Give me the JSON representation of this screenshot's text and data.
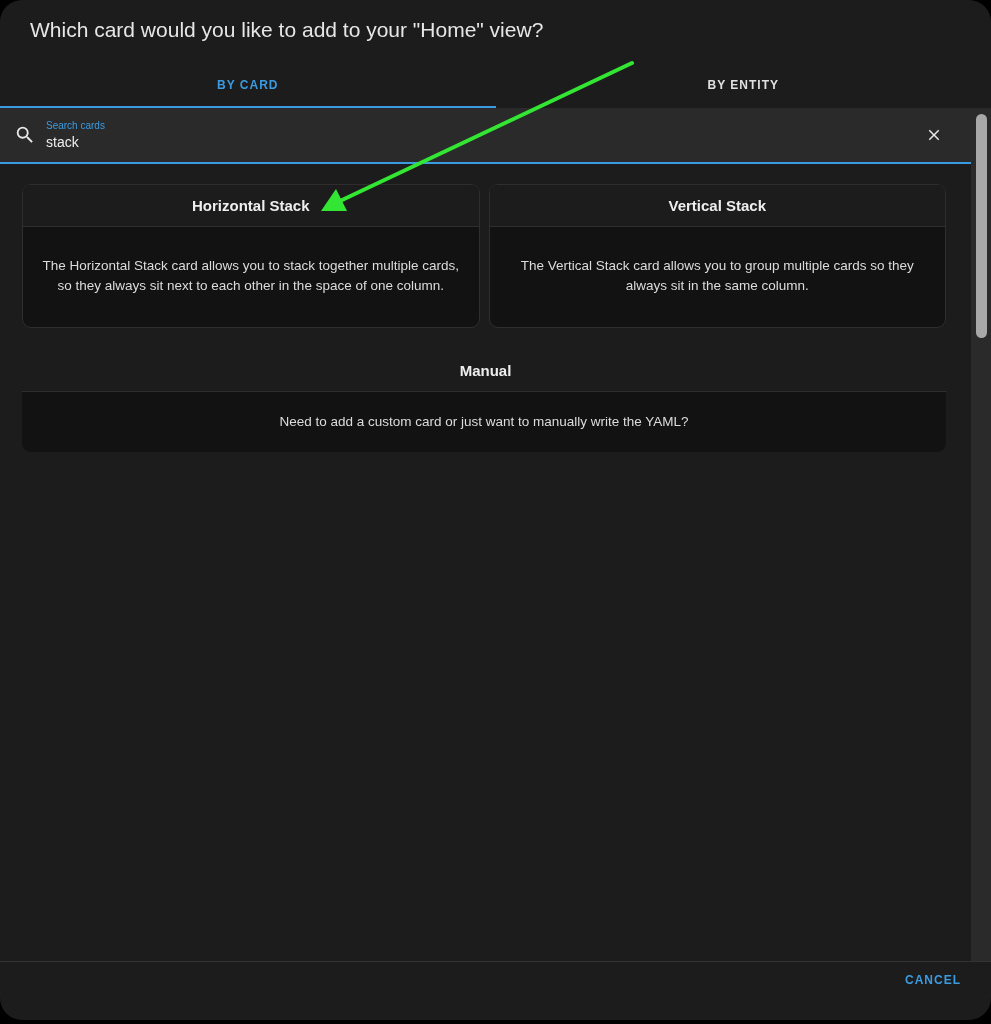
{
  "dialog": {
    "title": "Which card would you like to add to your \"Home\" view?"
  },
  "tabs": [
    {
      "label": "BY CARD",
      "selected": true
    },
    {
      "label": "BY ENTITY",
      "selected": false
    }
  ],
  "search": {
    "label": "Search cards",
    "value": "stack"
  },
  "cards": [
    {
      "title": "Horizontal Stack",
      "description": "The Horizontal Stack card allows you to stack together multiple cards, so they always sit next to each other in the space of one column."
    },
    {
      "title": "Vertical Stack",
      "description": "The Vertical Stack card allows you to group multiple cards so they always sit in the same column."
    }
  ],
  "manual": {
    "title": "Manual",
    "description": "Need to add a custom card or just want to manually write the YAML?"
  },
  "footer": {
    "cancel": "CANCEL"
  }
}
